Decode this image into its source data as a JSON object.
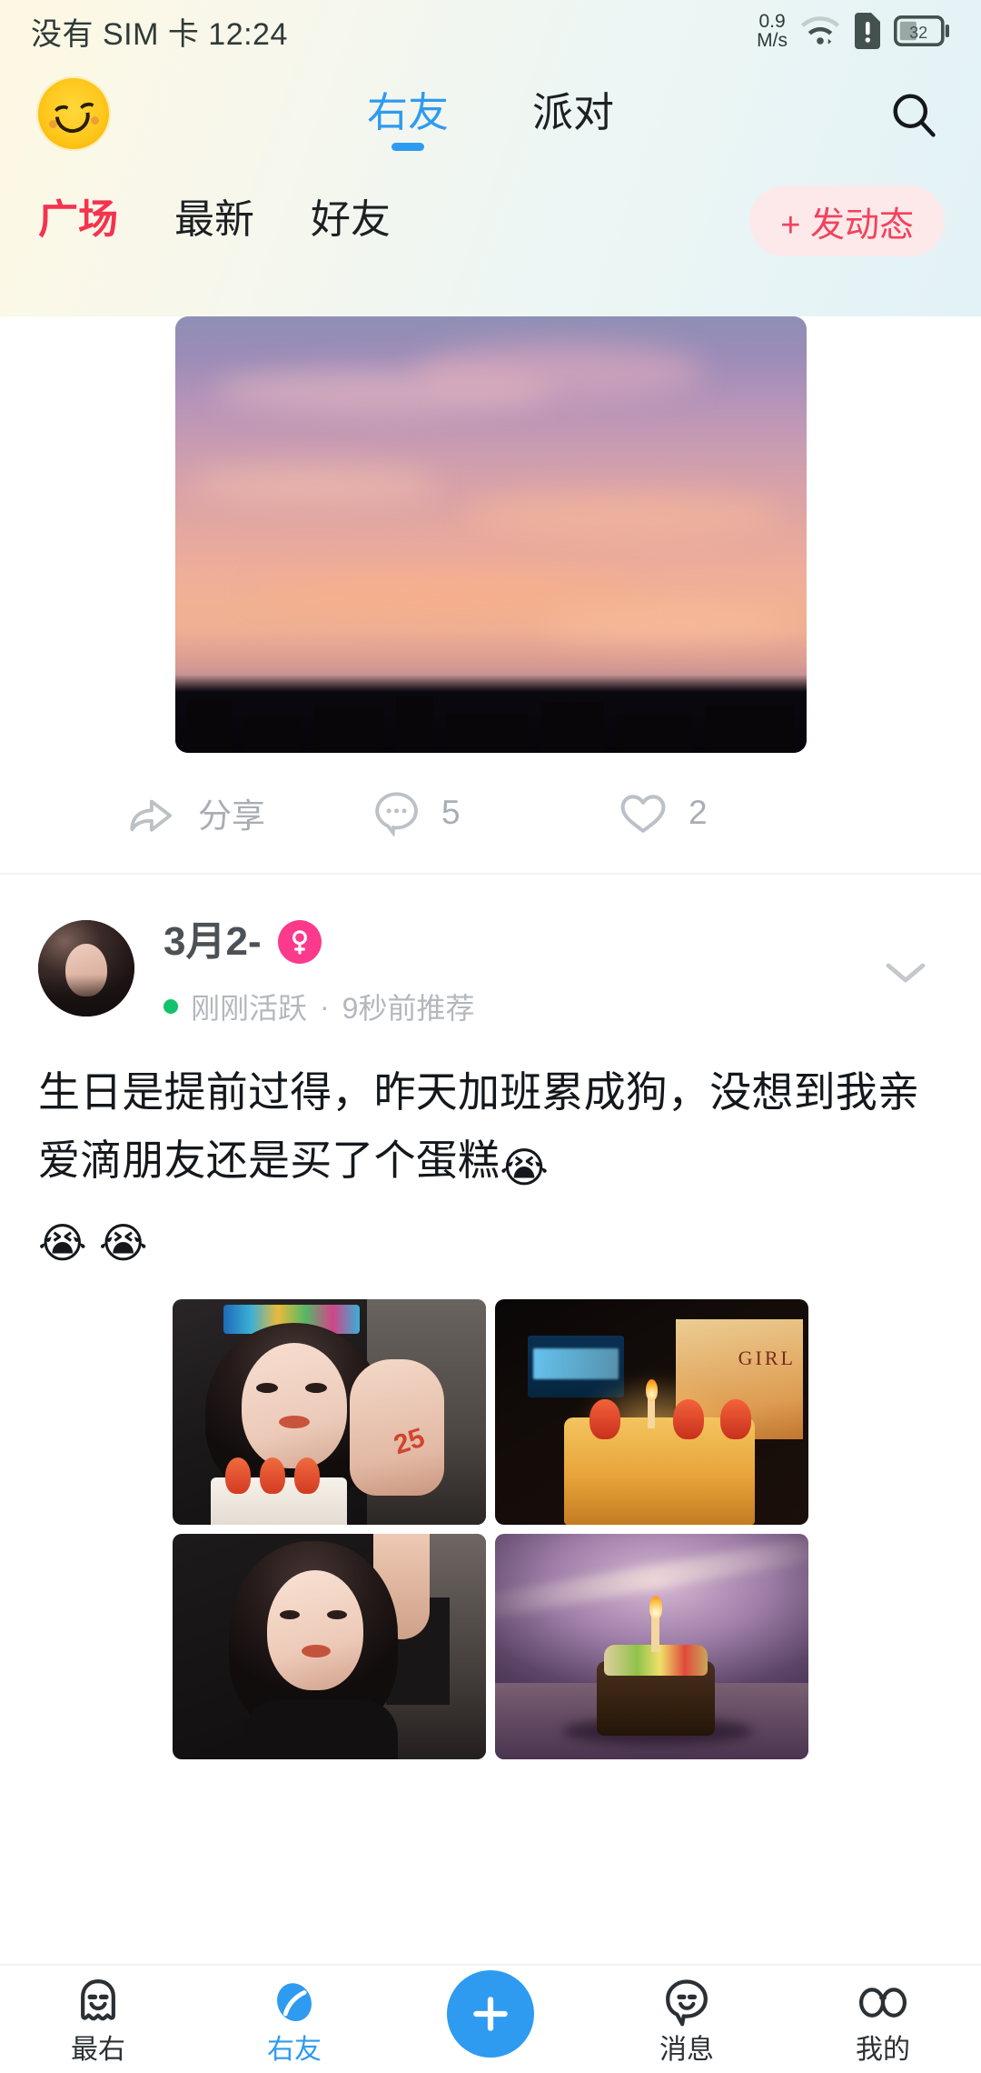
{
  "statusbar": {
    "carrier_time": "没有 SIM 卡 12:24",
    "net_speed_value": "0.9",
    "net_speed_unit": "M/s",
    "wifi_icon": "wifi-icon",
    "sim_alert_icon": "sim-alert-icon",
    "battery_level": "32"
  },
  "topnav": {
    "avatar_icon": "smiley-avatar-icon",
    "tabs": [
      {
        "label": "右友",
        "active": true
      },
      {
        "label": "派对",
        "active": false
      }
    ],
    "search_icon": "search-icon"
  },
  "subnav": {
    "tabs": [
      {
        "label": "广场",
        "active": true
      },
      {
        "label": "最新",
        "active": false
      },
      {
        "label": "好友",
        "active": false
      }
    ],
    "post_button": "+ 发动态",
    "active_color": "#f5334f",
    "post_button_bg": "#fde9ea"
  },
  "feed": {
    "posts": [
      {
        "id": "post-sunset",
        "hero_image_alt": "purple-orange sunset sky over city skyline",
        "actions": {
          "share_icon": "share-icon",
          "share_label": "分享",
          "comment_icon": "comment-icon",
          "comment_count": "5",
          "like_icon": "heart-icon",
          "like_count": "2"
        }
      },
      {
        "id": "post-birthday",
        "author": {
          "avatar_alt": "long-haired woman profile photo",
          "name": "3月2-",
          "gender_badge": "female-icon",
          "status_dot_color": "#13c26b",
          "status": "刚刚活跃",
          "separator": "·",
          "time": "9秒前推荐"
        },
        "collapse_icon": "chevron-down-icon",
        "text": "生日是提前过得，昨天加班累成狗，没想到我亲爱滴朋友还是买了个蛋糕",
        "emoji_inline": "😭",
        "emoji_line2": "😭 😭",
        "images": [
          {
            "alt": "girl with birthday crown holding hand with 25 drawn"
          },
          {
            "alt": "birthday cake with strawberries and candle, phone screen 祝我生日快乐"
          },
          {
            "alt": "selfie of girl in black top"
          },
          {
            "alt": "chocolate cake with fruit and lit candle"
          }
        ]
      }
    ]
  },
  "bottomnav": {
    "items": [
      {
        "label": "最右",
        "icon": "ghost-icon",
        "active": false
      },
      {
        "label": "右友",
        "icon": "planet-icon",
        "active": true
      },
      {
        "label": "",
        "icon": "plus-fab-icon",
        "active": false
      },
      {
        "label": "消息",
        "icon": "chat-face-icon",
        "active": false
      },
      {
        "label": "我的",
        "icon": "glasses-icon",
        "active": false
      }
    ],
    "accent_color": "#2e9bf0"
  }
}
